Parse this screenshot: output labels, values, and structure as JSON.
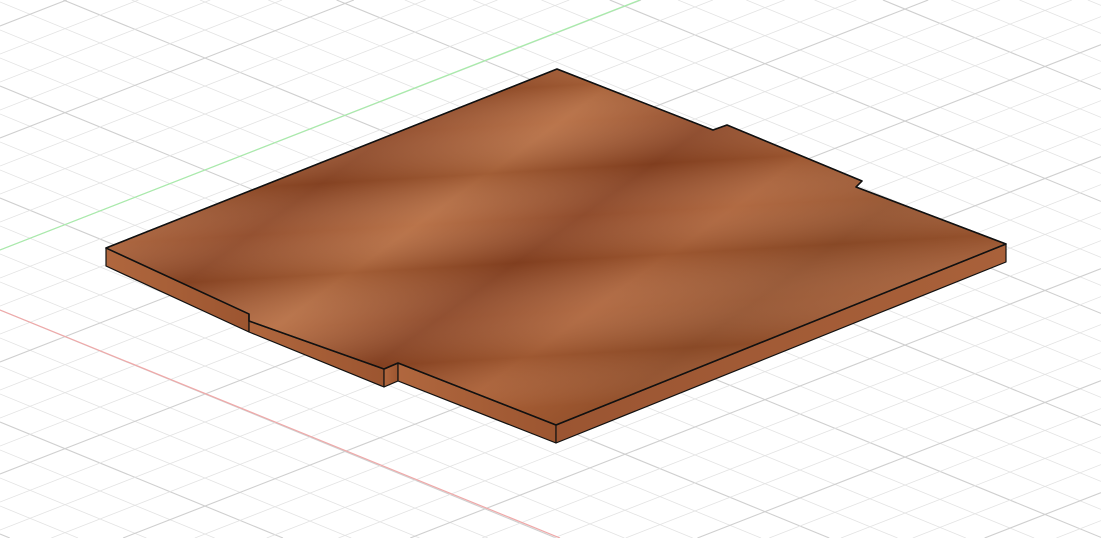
{
  "viewport": {
    "background": "#ffffff",
    "grid_minor_color": "#e3e3e3",
    "grid_major_color": "#cfcfcf",
    "x_axis_color": "#f0a8a8",
    "y_axis_color": "#a8ecaa"
  },
  "model": {
    "material": "wood",
    "top_color": "#9a4f2a",
    "side_color": "#a85a34",
    "edge_color": "#111111"
  }
}
